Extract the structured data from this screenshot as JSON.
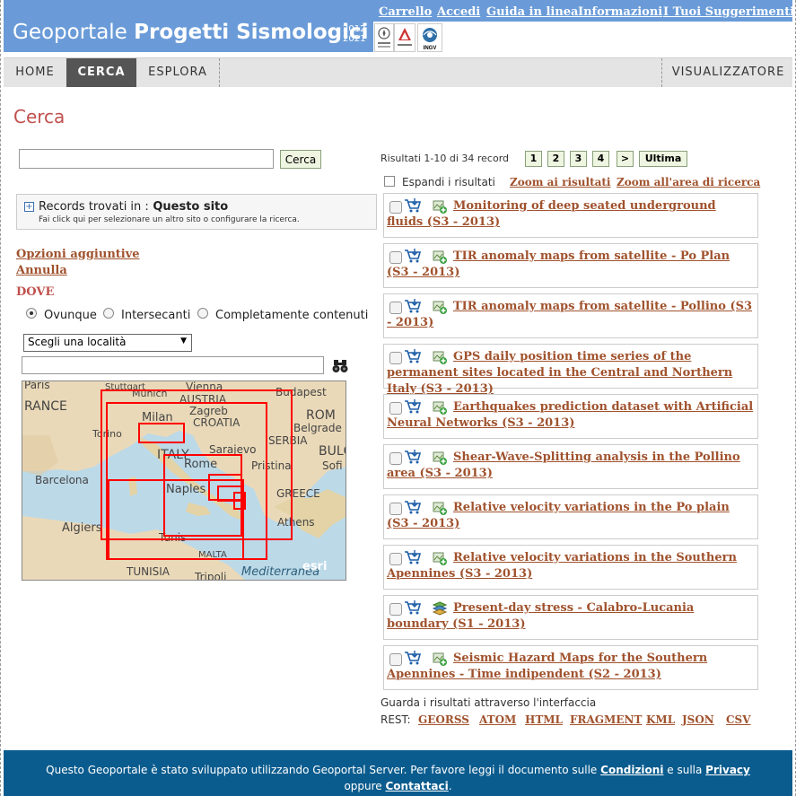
{
  "header": {
    "logo_prefix": "Geoportale",
    "logo_bold": "Progetti Sismologici",
    "year_top": "2012",
    "year_bottom": "2021",
    "links": [
      "Carrello",
      "Accedi",
      "Guida in linea",
      "Informazioni",
      "I Tuoi Suggerimenti"
    ],
    "partner_logo_label": "INGV"
  },
  "nav": {
    "tabs": [
      "HOME",
      "CERCA",
      "ESPLORA"
    ],
    "active": "CERCA",
    "right": "VISUALIZZATORE"
  },
  "page_title": "Cerca",
  "search": {
    "value": "",
    "button": "Cerca"
  },
  "records": {
    "title_prefix": "Records trovati in :",
    "title_site": "Questo sito",
    "subtitle": "Fai click qui per selezionare un altro sito o configurare la ricerca."
  },
  "options": {
    "more": "Opzioni aggiuntive",
    "cancel": "Annulla"
  },
  "where": {
    "label": "DOVE",
    "radios": [
      "Ovunque",
      "Intersecanti",
      "Completamente contenuti"
    ],
    "selected": "Ovunque",
    "location_select": "Scegli una località",
    "location_input": ""
  },
  "map_labels": {
    "france": "RANCE",
    "paris": "Paris",
    "stuttgart": "Stuttgart",
    "munich": "Munich",
    "vienna": "Vienna",
    "austria": "AUSTRIA",
    "budapest": "Budapest",
    "zagreb": "Zagreb",
    "croatia": "CROATIA",
    "rom": "ROM",
    "milan": "Milan",
    "torino": "Torino",
    "belgrade": "Belgrade",
    "serbia": "SERBIA",
    "bulg": "BULG",
    "italy": "ITALY",
    "sarajevo": "Sarajevo",
    "rome": "Rome",
    "pristina": "Pristina",
    "sofi": "Sofi",
    "barcelona": "Barcelona",
    "naples": "Naples",
    "greece": "GREECE",
    "algiers": "Algiers",
    "athens": "Athens",
    "tunis": "Tunis",
    "malta": "MALTA",
    "tunisia": "TUNISIA",
    "tripoli": "Tripoli",
    "sea": "Mediterranea",
    "esri": "esri"
  },
  "results": {
    "count_text": "Risultati 1-10 di 34 record",
    "pages": [
      "1",
      "2",
      "3",
      "4",
      ">",
      "Ultima"
    ],
    "expand_label": "Espandi i risultati",
    "zoom_results": "Zoom ai risultati",
    "zoom_area": "Zoom all'area di ricerca",
    "items": [
      {
        "title": "Monitoring of deep seated underground fluids (S3 - 2013)",
        "icon": "map-add-icon"
      },
      {
        "title": "TIR anomaly maps from satellite - Po Plan (S3 - 2013)",
        "icon": "map-add-icon"
      },
      {
        "title": "TIR anomaly maps from satellite - Pollino (S3 - 2013)",
        "icon": "map-add-icon"
      },
      {
        "title": "GPS daily position time series of the permanent sites located in the Central and Northern Italy (S3 - 2013)",
        "icon": "map-add-icon"
      },
      {
        "title": "Earthquakes prediction dataset with Artificial Neural Networks (S3 - 2013)",
        "icon": "map-add-icon"
      },
      {
        "title": "Shear-Wave-Splitting analysis in the Pollino area (S3 - 2013)",
        "icon": "map-add-icon"
      },
      {
        "title": "Relative velocity variations in the Po plain (S3 - 2013)",
        "icon": "map-add-icon"
      },
      {
        "title": "Relative velocity variations in the Southern Apennines (S3 - 2013)",
        "icon": "map-add-icon"
      },
      {
        "title": "Present-day stress - Calabro-Lucania boundary (S1 - 2013)",
        "icon": "layers-icon"
      },
      {
        "title": "Seismic Hazard Maps for the Southern Apennines - Time indipendent (S2 - 2013)",
        "icon": "map-add-icon"
      }
    ],
    "guarda": "Guarda i risultati attraverso l'interfaccia",
    "rest_label": "REST:",
    "rest_links": [
      "GEORSS",
      "ATOM",
      "HTML",
      "FRAGMENT",
      "KML",
      "JSON",
      "CSV"
    ]
  },
  "footer": {
    "line1_a": "Questo Geoportale è stato sviluppato utilizzando Geoportal Server. Per favore leggi il documento sulle",
    "link_conditions": "Condizioni",
    "line1_b": "e sulla",
    "link_privacy": "Privacy",
    "line2_a": "oppure",
    "link_contact": "Contattaci",
    "line2_b": "."
  },
  "colors": {
    "header_blue": "#6a9bd8",
    "link_brown": "#a0522d",
    "title_red": "#c0504d",
    "footer_blue": "#0b5c8e",
    "extent_red": "#ff0000"
  }
}
